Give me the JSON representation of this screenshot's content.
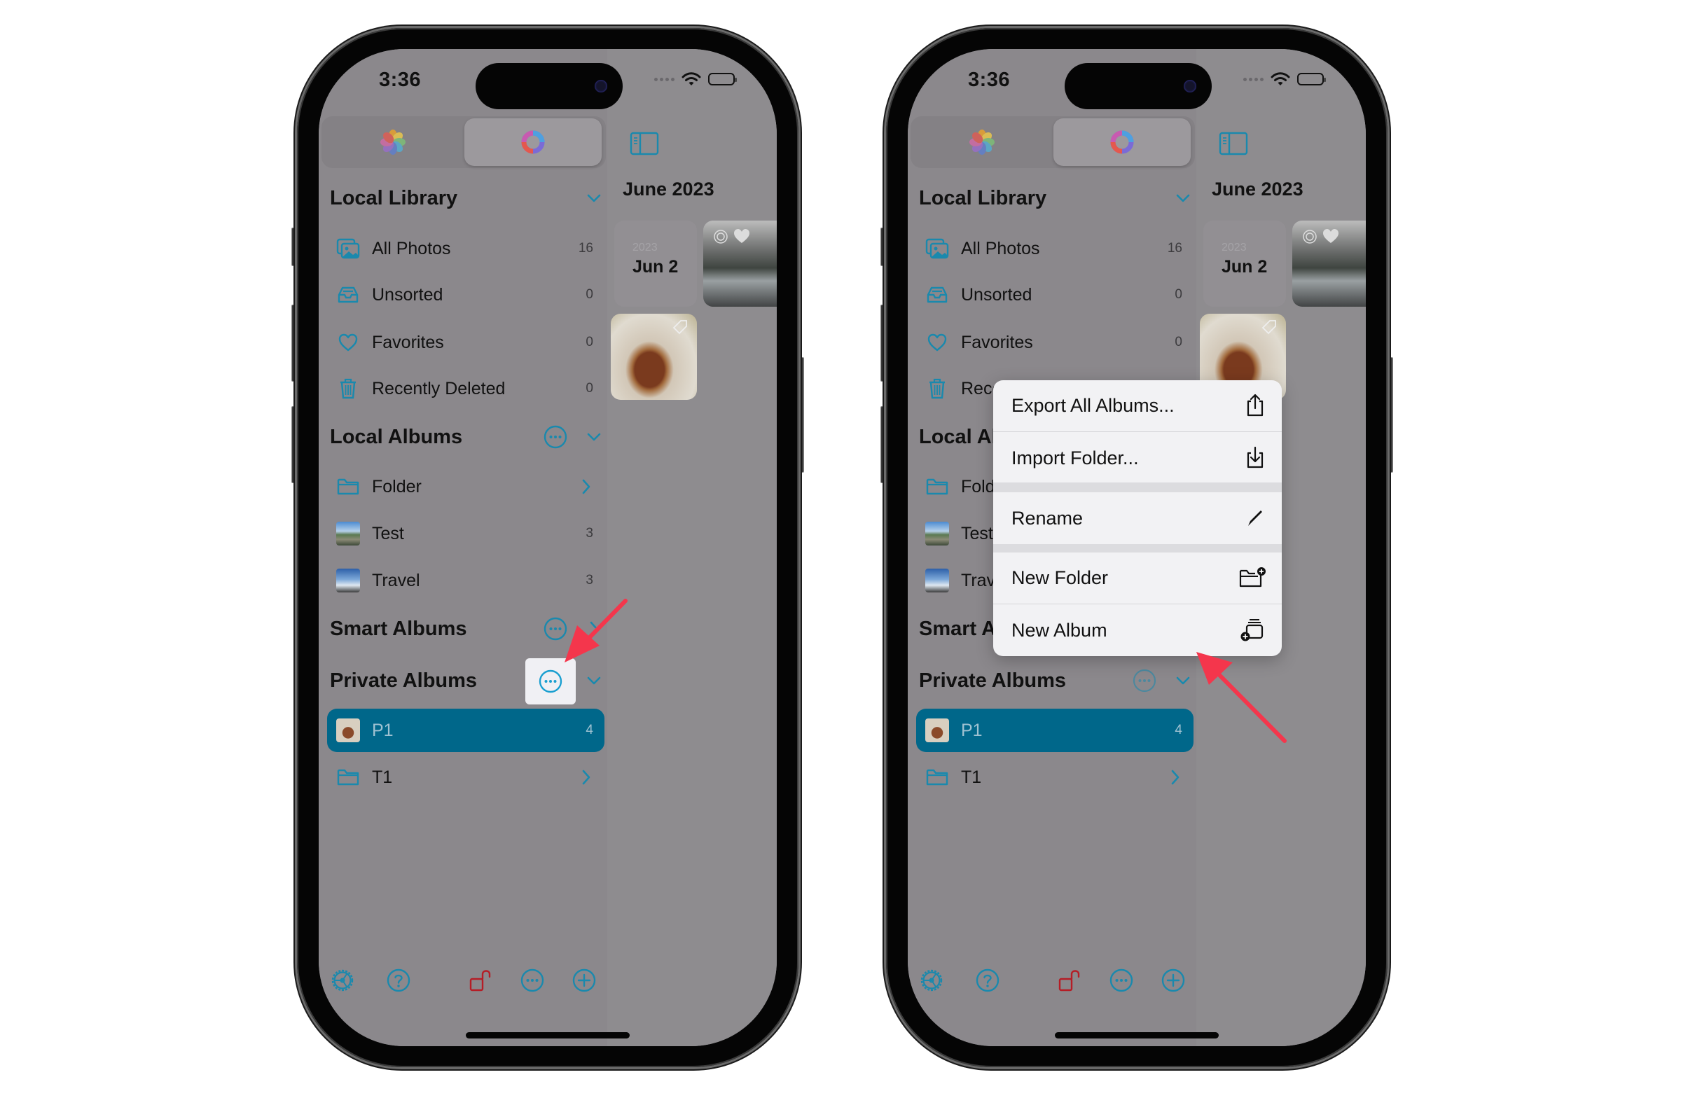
{
  "colors": {
    "accent": "#1a89ad",
    "accent_selected_row": "#00678a",
    "lock_red": "#b51d26",
    "annotation_arrow": "#f4364c",
    "dim_overlay_gray": "#8c898d"
  },
  "status_bar": {
    "time": "3:36"
  },
  "segmented_control": {
    "items": [
      {
        "icon": "photos-flower-icon",
        "selected": false
      },
      {
        "icon": "app-ring-icon",
        "selected": true
      }
    ]
  },
  "sidebar": {
    "sections": [
      {
        "title": "Local Library",
        "expanded": true,
        "items": [
          {
            "label": "All Photos",
            "icon": "photo-stack-icon",
            "count": "16"
          },
          {
            "label": "Unsorted",
            "icon": "tray-icon",
            "count": "0"
          },
          {
            "label": "Favorites",
            "icon": "heart-icon",
            "count": "0"
          },
          {
            "label": "Recently Deleted",
            "icon": "trash-icon",
            "count": "0"
          }
        ]
      },
      {
        "title": "Local Albums",
        "expanded": true,
        "items": [
          {
            "label": "Folder",
            "icon": "folder-icon",
            "count": ""
          },
          {
            "label": "Test",
            "icon": "album-thumbnail",
            "count": "3"
          },
          {
            "label": "Travel",
            "icon": "album-thumbnail",
            "count": "3"
          }
        ]
      },
      {
        "title": "Smart Albums",
        "expanded": false,
        "items": []
      },
      {
        "title": "Private Albums",
        "expanded": true,
        "items": [
          {
            "label": "P1",
            "icon": "album-thumbnail",
            "count": "4",
            "selected": true
          },
          {
            "label": "T1",
            "icon": "folder-icon",
            "count": ""
          }
        ]
      }
    ],
    "toolbar": [
      "settings-icon",
      "help-icon",
      "unlock-icon",
      "more-icon",
      "add-icon"
    ]
  },
  "content": {
    "month_title": "June 2023",
    "date_card": {
      "year": "2023",
      "day": "Jun 2"
    }
  },
  "context_menu": {
    "items": [
      {
        "label": "Export All Albums...",
        "icon": "share-icon"
      },
      {
        "label": "Import Folder...",
        "icon": "import-icon"
      },
      {
        "label": "Rename",
        "icon": "pencil-icon"
      },
      {
        "label": "New Folder",
        "icon": "folder-add-icon"
      },
      {
        "label": "New Album",
        "icon": "album-add-icon"
      }
    ]
  }
}
